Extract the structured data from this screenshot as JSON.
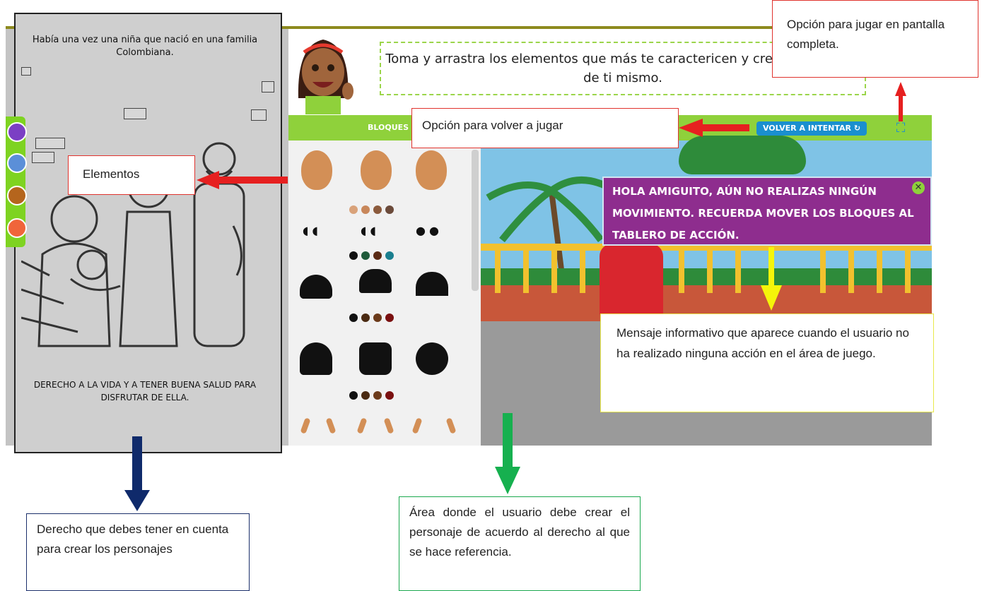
{
  "story": {
    "text": "Había una vez una niña que nació en una familia Colombiana.",
    "footer": "DERECHO A LA VIDA Y A TENER BUENA SALUD PARA DISFRUTAR DE ELLA."
  },
  "header": {
    "instruction": "Toma y arrastra los elementos que más te caractericen y crea una imagen de ti mismo."
  },
  "toolbar": {
    "bloques_label": "BLOQUES",
    "retry_label": "VOLVER A INTENTAR",
    "retry_icon": "refresh-icon",
    "fullscreen_icon": "fullscreen-icon"
  },
  "sidebar": {
    "icons": [
      "home-icon",
      "friends-icon",
      "girl-avatar-icon",
      "edit-icon"
    ]
  },
  "palette": {
    "skin_colors": [
      "#d9a27a",
      "#c8875a",
      "#8b5a3c",
      "#6b4a3a"
    ],
    "eye_colors": [
      "#111111",
      "#1f5a3a",
      "#5a2a14",
      "#1a7f8f"
    ],
    "hair_colors": [
      "#111111",
      "#4a2a12",
      "#6b3a1a",
      "#7a1010"
    ],
    "hair_colors_2": [
      "#111111",
      "#4a2a12",
      "#6b3a1a",
      "#7a1010"
    ]
  },
  "message": {
    "text": "HOLA AMIGUITO, AÚN NO REALIZAS NINGÚN MOVIMIENTO. RECUERDA MOVER LOS BLOQUES AL TABLERO DE ACCIÓN."
  },
  "callouts": {
    "fullscreen": "Opción para jugar en pantalla completa.",
    "retry": "Opción para volver a jugar",
    "elements": "Elementos",
    "message": "Mensaje informativo que aparece cuando el usuario no ha realizado ninguna acción en el área de juego.",
    "right": "Derecho que debes tener en cuenta para crear los personajes",
    "area": "Área donde el usuario debe crear el personaje de acuerdo al derecho al que se hace referencia."
  },
  "colors": {
    "green_accent": "#8fd13b",
    "message_purple": "#8e2d8e",
    "retry_blue": "#1a8fcf",
    "arrow_red": "#e62020",
    "arrow_yellow": "#f5f50a",
    "arrow_navy": "#0f2a6b",
    "arrow_green": "#16b04f"
  }
}
